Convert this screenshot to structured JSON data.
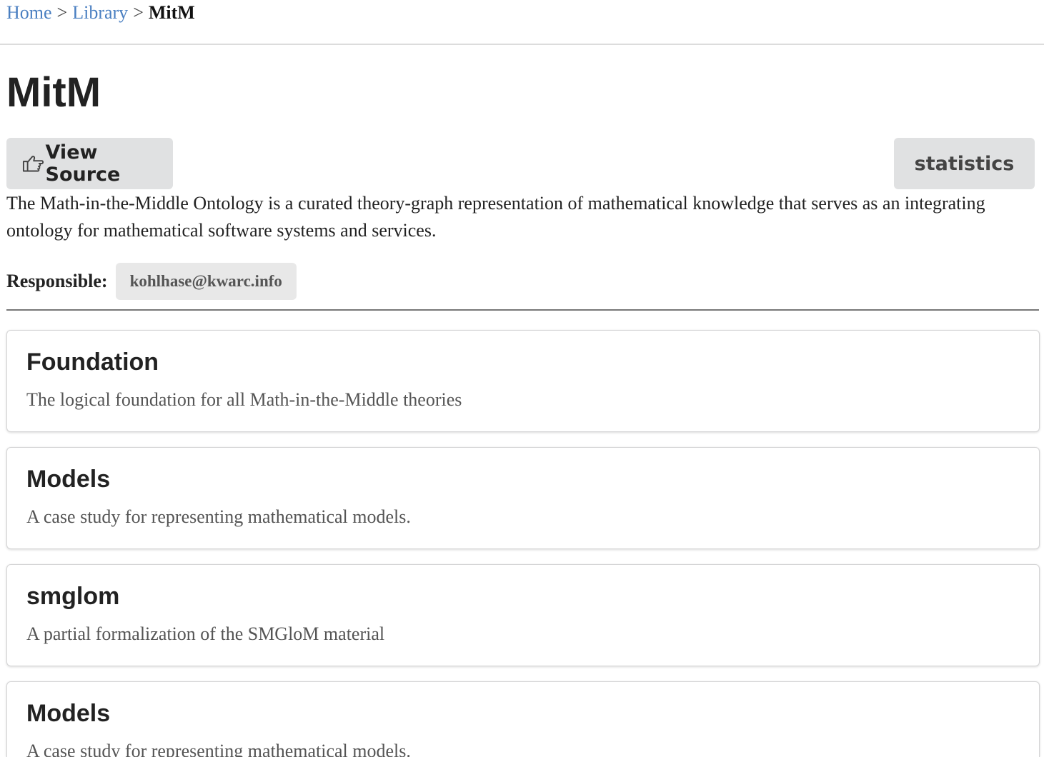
{
  "breadcrumb": {
    "items": [
      {
        "label": "Home"
      },
      {
        "label": "Library"
      }
    ],
    "separator": ">",
    "current": "MitM"
  },
  "page": {
    "title": "MitM",
    "description": "The Math-in-the-Middle Ontology is a curated theory-graph representation of mathematical knowledge that serves as an integrating ontology for mathematical software systems and services."
  },
  "actions": {
    "view_source_label": "View Source",
    "view_source_icon": "hand-point-right-icon",
    "statistics_label": "statistics"
  },
  "responsible": {
    "label": "Responsible:",
    "email": "kohlhase@kwarc.info"
  },
  "archives": [
    {
      "title": "Foundation",
      "description": "The logical foundation for all Math-in-the-Middle theories"
    },
    {
      "title": "Models",
      "description": "A case study for representing mathematical models."
    },
    {
      "title": "smglom",
      "description": "A partial formalization of the SMGloM material"
    },
    {
      "title": "Models",
      "description": "A case study for representing mathematical models."
    }
  ],
  "colors": {
    "link": "#4a7fc1",
    "button_bg": "#e0e1e2",
    "badge_bg": "#e8e8e8",
    "card_border": "#d4d4d5"
  }
}
